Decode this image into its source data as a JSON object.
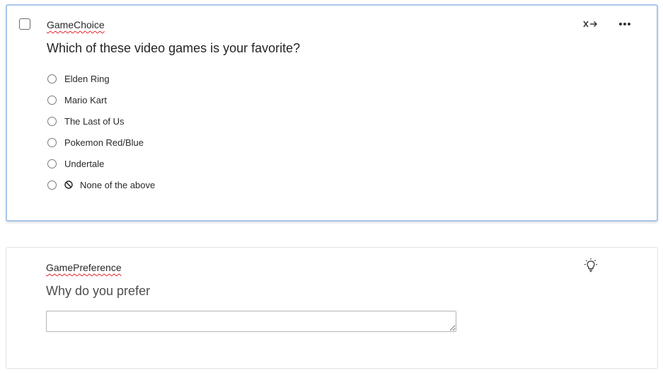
{
  "questions": [
    {
      "id": "GameChoice",
      "text": "Which of these video games is your favorite?",
      "choices": [
        {
          "label": "Elden Ring"
        },
        {
          "label": "Mario Kart"
        },
        {
          "label": "The Last of Us"
        },
        {
          "label": "Pokemon Red/Blue"
        },
        {
          "label": "Undertale"
        },
        {
          "label": "None of the above",
          "exclusive": true
        }
      ],
      "icons": [
        "x-arrow-icon",
        "more-options-icon"
      ]
    },
    {
      "id": "GamePreference",
      "text": "Why do you prefer",
      "answer_value": "",
      "icons": [
        "lightbulb-icon"
      ]
    }
  ],
  "colors": {
    "selected_border": "#a9c6e8",
    "card_border": "#e1e1e1",
    "spellcheck_underline": "#e0242b"
  }
}
